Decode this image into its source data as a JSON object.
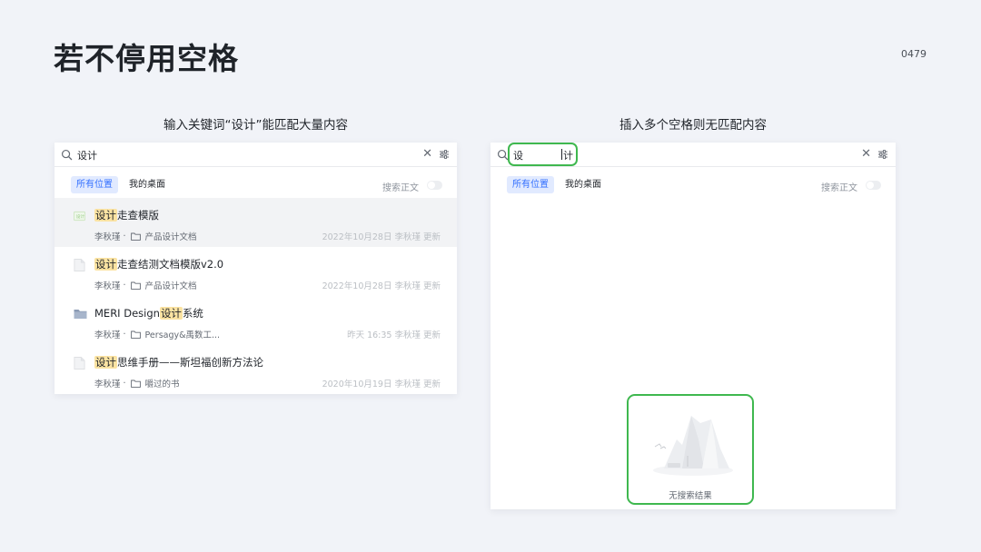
{
  "slide": {
    "title": "若不停用空格",
    "page_number": "0479"
  },
  "left": {
    "caption": "输入关键词“设计”能匹配大量内容",
    "search": {
      "query": "设计",
      "clear_icon": "close-icon",
      "filter_icon": "filter-icon"
    },
    "tabs": [
      "所有位置",
      "我的桌面"
    ],
    "fulltext_label": "搜索正文",
    "results": [
      {
        "highlight": "设计",
        "rest": "走查模版",
        "icon": "sheet-icon",
        "owner": "李秋瑾",
        "location": "产品设计文档",
        "time": "2022年10月28日 李秋瑾 更新"
      },
      {
        "highlight": "设计",
        "rest": "走查结测文档模版v2.0",
        "icon": "doc-icon",
        "owner": "李秋瑾",
        "location": "产品设计文档",
        "time": "2022年10月28日 李秋瑾 更新"
      },
      {
        "prefix": "MERI Design",
        "highlight": "设计",
        "rest": "系统",
        "icon": "folder-icon",
        "owner": "李秋瑾",
        "location": "Persagy&禹数工...",
        "time": "昨天 16:35 李秋瑾 更新"
      },
      {
        "highlight": "设计",
        "rest": "思维手册——斯坦福创新方法论",
        "icon": "doc-icon",
        "owner": "李秋瑾",
        "location": "嚼过的书",
        "time": "2020年10月19日 李秋瑾 更新"
      }
    ]
  },
  "right": {
    "caption": "插入多个空格则无匹配内容",
    "search": {
      "part1": "设",
      "part2": "计"
    },
    "tabs": [
      "所有位置",
      "我的桌面"
    ],
    "fulltext_label": "搜索正文",
    "empty_text": "无搜索结果"
  },
  "colors": {
    "accent": "#3370ff",
    "highlight": "#fbe3a2",
    "annotation": "#3fb84f"
  }
}
